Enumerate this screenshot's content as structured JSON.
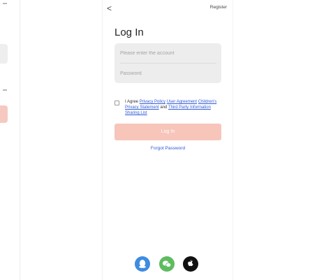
{
  "app": {
    "register_label": "Register",
    "title": "Log In",
    "back_glyph": "<"
  },
  "form": {
    "account_placeholder": "Please enter the account",
    "password_placeholder": "Password"
  },
  "agreement": {
    "prefix": "I Agree ",
    "privacy_policy": "Privacy Policy",
    "user_agreement": "User Agreement",
    "childrens_privacy": "Children's Privacy Statement",
    "and": " and ",
    "third_party": "Third Party Information Sharing List"
  },
  "actions": {
    "login_label": "Log In",
    "forgot_label": "Forgot Password"
  },
  "social": {
    "icons": [
      "qq-icon",
      "wechat-icon",
      "apple-icon"
    ]
  },
  "colors": {
    "accent_link": "#2f5ad6",
    "login_button_disabled": "#f7c5ba",
    "qq": "#3d8ce0",
    "wechat": "#5dbc5f",
    "apple": "#111111"
  }
}
